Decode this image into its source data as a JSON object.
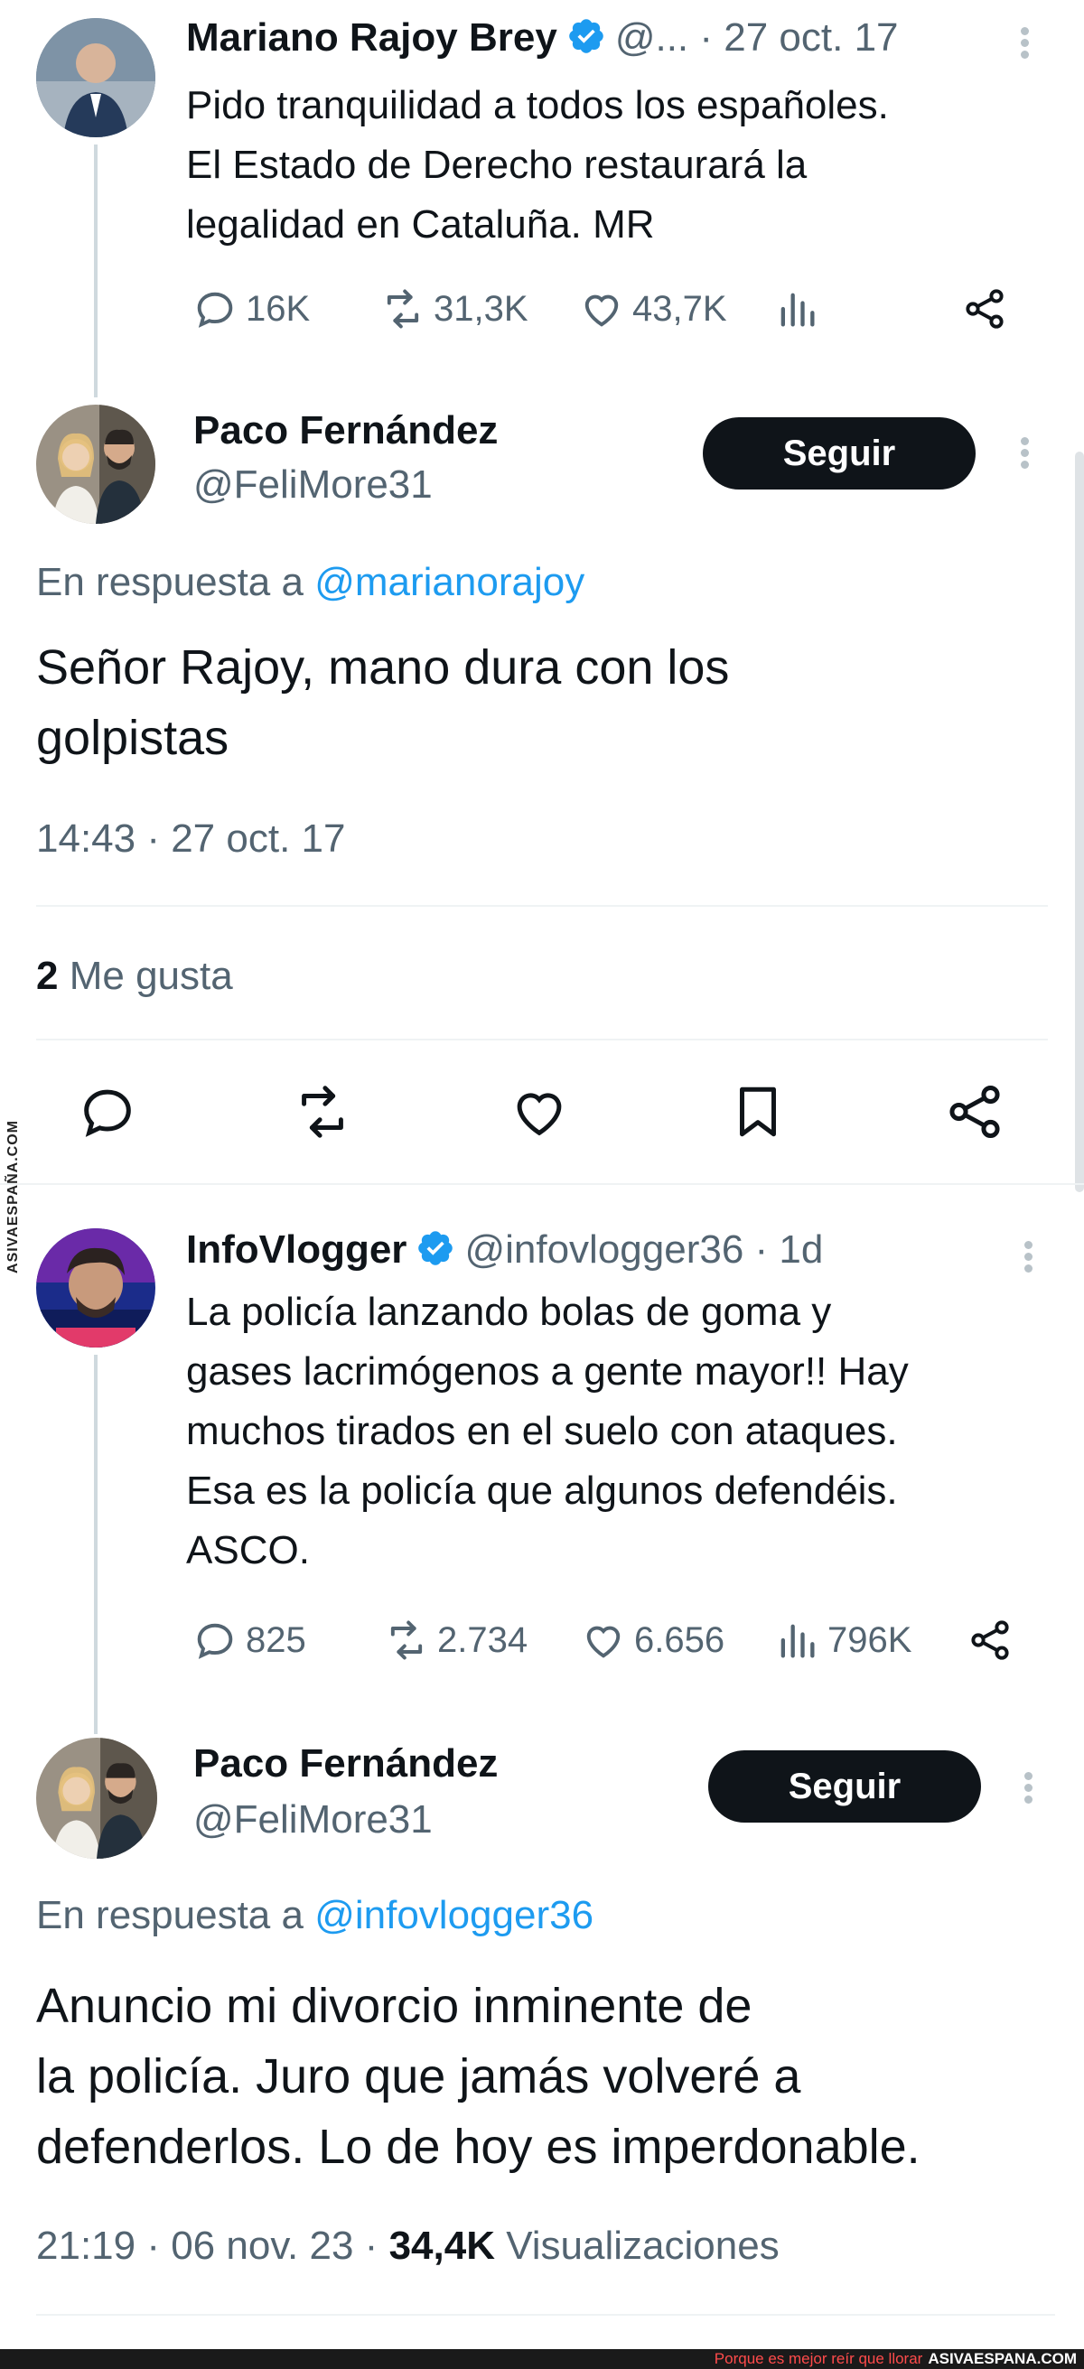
{
  "tweet1": {
    "name": "Mariano Rajoy Brey",
    "handle_date": "@... · 27 oct. 17",
    "text_lines": [
      "Pido tranquilidad a todos los españoles.",
      "El Estado de Derecho restaurará la",
      "legalidad en Cataluña. MR"
    ],
    "replies": "16K",
    "retweets": "31,3K",
    "likes": "43,7K"
  },
  "reply1": {
    "name": "Paco Fernández",
    "handle": "@FeliMore31",
    "follow_label": "Seguir",
    "reply_prefix": "En respuesta a",
    "reply_mention": "@marianorajoy",
    "text_lines": [
      "Señor Rajoy, mano dura con los",
      "golpistas"
    ],
    "timestamp": "14:43 · 27 oct. 17",
    "likes_count": "2",
    "likes_label": "Me gusta"
  },
  "tweet2": {
    "name": "InfoVlogger",
    "handle_date": "@infovlogger36 · 1d",
    "text_lines": [
      "La policía lanzando bolas de goma y",
      "gases lacrimógenos a gente mayor!! Hay",
      "muchos tirados en el suelo con ataques.",
      "Esa es la policía que algunos defendéis.",
      "ASCO."
    ],
    "replies": "825",
    "retweets": "2.734",
    "likes": "6.656",
    "views": "796K"
  },
  "reply2": {
    "name": "Paco Fernández",
    "handle": "@FeliMore31",
    "follow_label": "Seguir",
    "reply_prefix": "En respuesta a",
    "reply_mention": "@infovlogger36",
    "text_lines": [
      "Anuncio mi divorcio inminente de",
      "la policía. Juro que jamás volveré a",
      "defenderlos. Lo de hoy es imperdonable."
    ],
    "timestamp": "21:19 · 06 nov. 23 ·",
    "views_count": "34,4K",
    "views_label": "Visualizaciones"
  },
  "watermark": {
    "side": "ASIVAESPAÑA.COM",
    "footer_tag": "Porque es mejor reír que llorar",
    "footer_site": "ASIVAESPANA.COM"
  },
  "colors": {
    "accent": "#1d9bf0",
    "muted": "#536471",
    "text": "#0f1419",
    "verified": "#1d9bf0"
  }
}
